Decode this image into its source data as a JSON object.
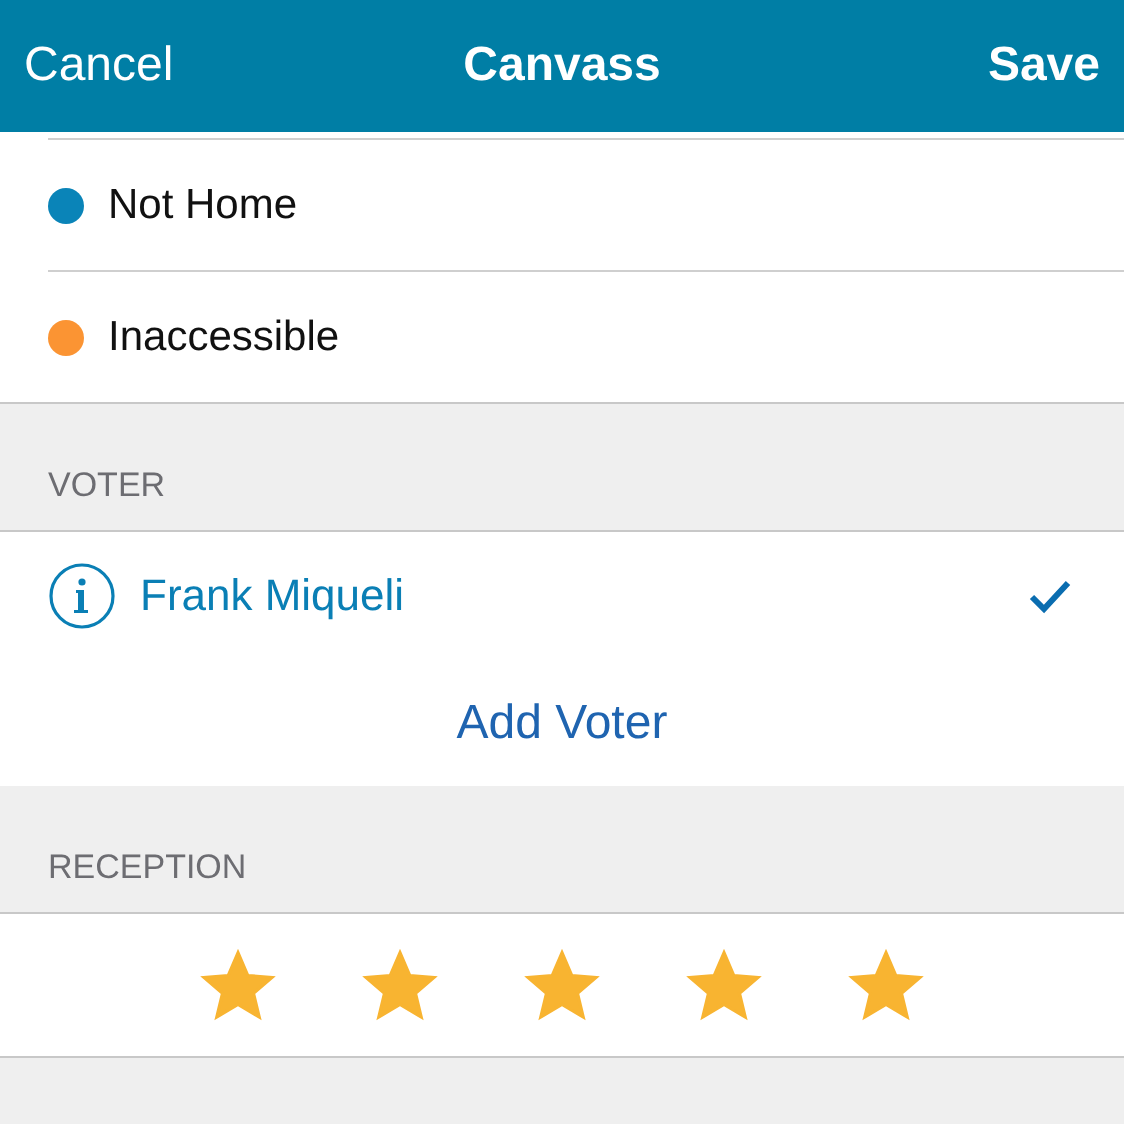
{
  "nav_bar": {
    "left": "Cancel",
    "title": "Canvass",
    "right": "Save"
  },
  "statuses": [
    {
      "label": "Not Home",
      "color": "#0a84b8"
    },
    {
      "label": "Inaccessible",
      "color": "#fb9433"
    }
  ],
  "voter": {
    "header": "VOTER",
    "voters": [
      {
        "name": "Frank Miqueli",
        "selected": true
      }
    ],
    "add_button": "Add Voter"
  },
  "reception": {
    "header": "RECEPTION",
    "stars": 5
  }
}
